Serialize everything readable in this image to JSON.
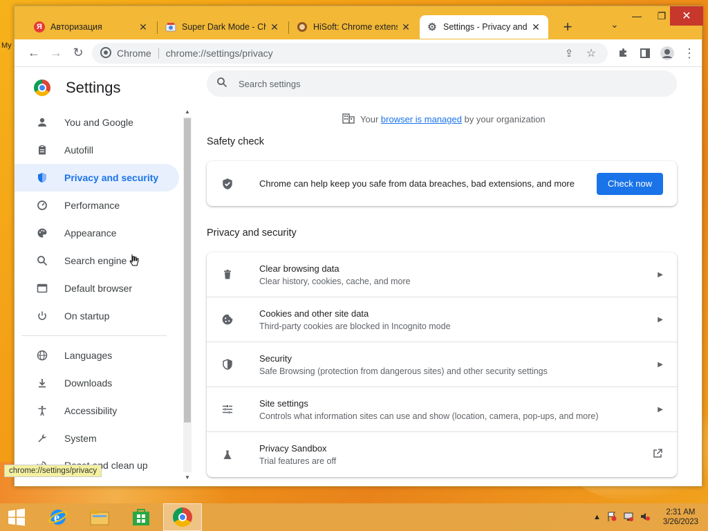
{
  "desktop": {
    "edge_text": "My"
  },
  "tabs": [
    {
      "title": "Авторизация",
      "favicon": "yandex-icon",
      "close": "✕"
    },
    {
      "title": "Super Dark Mode - Chro",
      "favicon": "chrome-web-store-icon",
      "close": "✕"
    },
    {
      "title": "HiSoft: Chrome extensio",
      "favicon": "hisoft-icon",
      "close": "✕"
    },
    {
      "title": "Settings - Privacy and se",
      "favicon": "gear-icon",
      "close": "✕"
    }
  ],
  "newtab_label": "+",
  "window_controls": {
    "minimize": "—",
    "maximize": "❐",
    "close": "✕"
  },
  "omnibox": {
    "chrome_label": "Chrome",
    "url": "chrome://settings/privacy"
  },
  "settings": {
    "title": "Settings",
    "search_placeholder": "Search settings",
    "managed_prefix": "Your",
    "managed_link": "browser is managed",
    "managed_suffix": "by your organization"
  },
  "nav": [
    {
      "label": "You and Google",
      "icon": "person-icon"
    },
    {
      "label": "Autofill",
      "icon": "clipboard-icon"
    },
    {
      "label": "Privacy and security",
      "icon": "shield-icon",
      "selected": true
    },
    {
      "label": "Performance",
      "icon": "speedometer-icon"
    },
    {
      "label": "Appearance",
      "icon": "palette-icon"
    },
    {
      "label": "Search engine",
      "icon": "search-icon"
    },
    {
      "label": "Default browser",
      "icon": "browser-icon"
    },
    {
      "label": "On startup",
      "icon": "power-icon"
    },
    {
      "label": "Languages",
      "icon": "globe-icon"
    },
    {
      "label": "Downloads",
      "icon": "download-icon"
    },
    {
      "label": "Accessibility",
      "icon": "accessibility-icon"
    },
    {
      "label": "System",
      "icon": "wrench-icon"
    },
    {
      "label": "Reset and clean up",
      "icon": "history-icon"
    }
  ],
  "safety_check": {
    "section_title": "Safety check",
    "text": "Chrome can help keep you safe from data breaches, bad extensions, and more",
    "button": "Check now"
  },
  "privacy": {
    "section_title": "Privacy and security",
    "rows": [
      {
        "title": "Clear browsing data",
        "subtitle": "Clear history, cookies, cache, and more",
        "icon": "trash-icon"
      },
      {
        "title": "Cookies and other site data",
        "subtitle": "Third-party cookies are blocked in Incognito mode",
        "icon": "cookie-icon"
      },
      {
        "title": "Security",
        "subtitle": "Safe Browsing (protection from dangerous sites) and other security settings",
        "icon": "shield-icon"
      },
      {
        "title": "Site settings",
        "subtitle": "Controls what information sites can use and show (location, camera, pop-ups, and more)",
        "icon": "tune-icon"
      },
      {
        "title": "Privacy Sandbox",
        "subtitle": "Trial features are off",
        "icon": "flask-icon"
      }
    ]
  },
  "status_url": "chrome://settings/privacy",
  "taskbar": {
    "time": "2:31 AM",
    "date": "3/26/2023"
  }
}
